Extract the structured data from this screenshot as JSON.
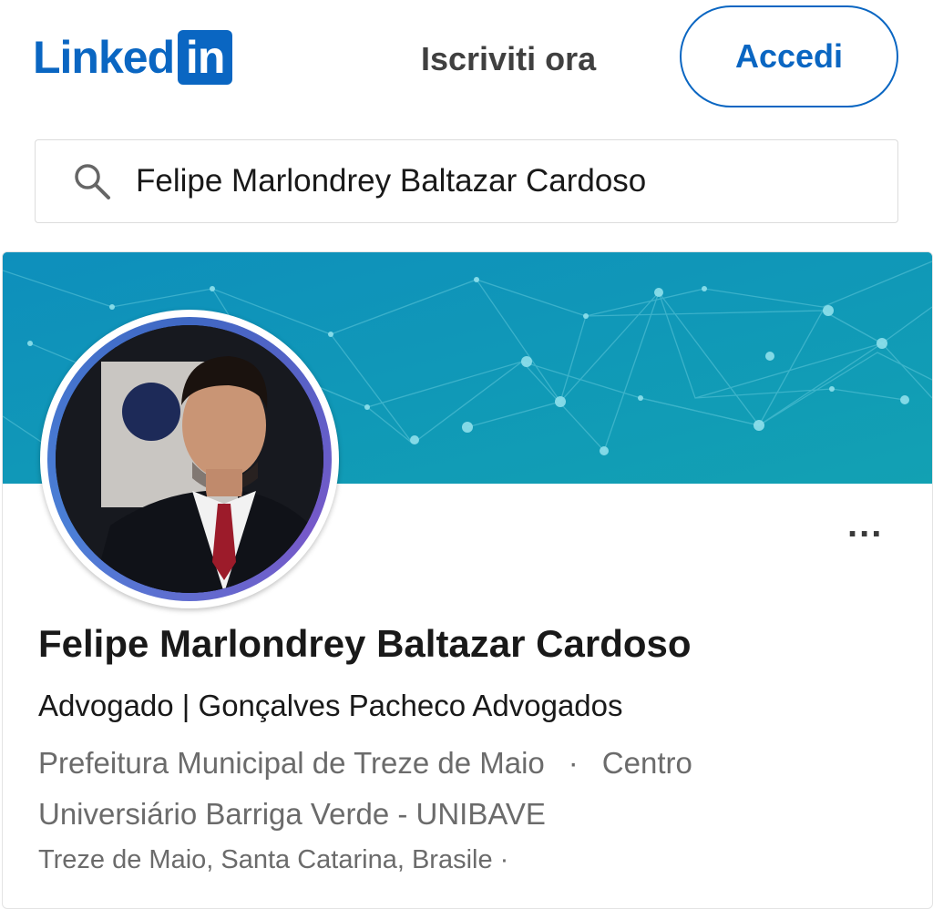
{
  "header": {
    "logo_word": "Linked",
    "logo_badge": "in",
    "join_label": "Iscriviti ora",
    "signin_label": "Accedi"
  },
  "search": {
    "value": "Felipe Marlondrey Baltazar Cardoso"
  },
  "profile": {
    "name": "Felipe Marlondrey Baltazar Cardoso",
    "headline": "Advogado | Gonçalves Pacheco Advogados",
    "org_1": "Prefeitura Municipal de Treze de Maio",
    "separator": "·",
    "org_2": "Centro Universiário Barriga Verde - UNIBAVE",
    "location": "Treze de Maio, Santa Catarina, Brasile",
    "location_sep": "·",
    "more_label": "..."
  },
  "colors": {
    "brand": "#0a66c2",
    "banner": "#0f94ba",
    "secondary_text": "#6b6b6b"
  },
  "icons": {
    "search": "search-icon",
    "more": "more-options-icon"
  }
}
